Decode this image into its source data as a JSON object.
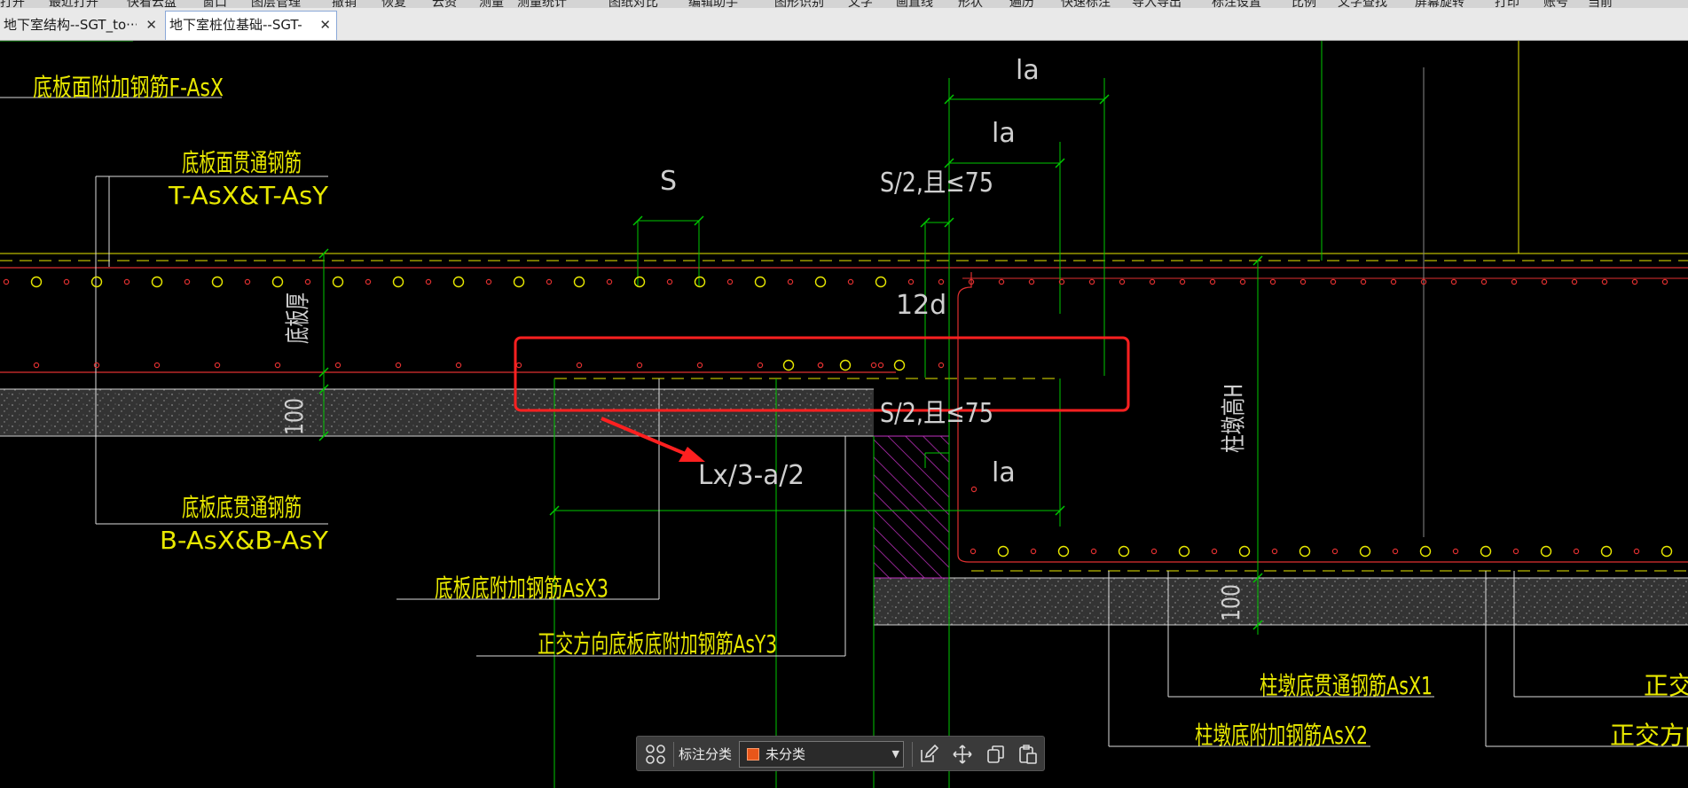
{
  "menubar": {
    "items": [
      "打开",
      "最近打开",
      "快看云盘",
      "窗口",
      "图层管理",
      "撤销",
      "恢复",
      "云资",
      "测量",
      "测量统计",
      "图纸对比",
      "编辑助手",
      "图形识别",
      "文字",
      "画直线",
      "形状",
      "遍历",
      "快速标注",
      "导入导出",
      "标注设置",
      "比例",
      "文字查找",
      "屏幕旋转",
      "打印",
      "账号",
      "当前"
    ]
  },
  "tabs": [
    {
      "label": "地下室结构--SGT_to···",
      "active": false,
      "close": "✕"
    },
    {
      "label": "地下室桩位基础--SGT-",
      "active": true,
      "close": "✕"
    }
  ],
  "drawing": {
    "labels": {
      "slab_top_extra": "底板面附加钢筋F-AsX",
      "slab_top_through_cn": "底板面贯通钢筋",
      "slab_top_through_code": "T-AsX&T-AsY",
      "slab_thickness": "底板厚",
      "cover_100_left": "100",
      "slab_bottom_through_cn": "底板底贯通钢筋",
      "slab_bottom_through_code": "B-AsX&B-AsY",
      "slab_bottom_extra": "底板底附加钢筋AsX3",
      "orth_bottom_extra": "正交方向底板底附加钢筋AsY3",
      "spacing_s": "S",
      "half_s_top": "S/2,且≤75",
      "half_s_bottom": "S/2,且≤75",
      "la_1": "la",
      "la_2": "la",
      "la_3": "la",
      "hook_12d": "12d",
      "lx_formula": "Lx/3-a/2",
      "cap_height": "柱墩高H",
      "cover_100_right": "100",
      "cap_bottom_through": "柱墩底贯通钢筋AsX1",
      "cap_bottom_extra": "柱墩底附加钢筋AsX2",
      "right_partial_1": "正交方",
      "right_partial_2": "正交方向柱"
    },
    "colors": {
      "text": "#e8e800",
      "dimension": "#00c800",
      "rebar": "#e03030",
      "concrete": "#6a6a6a",
      "highlight_box": "#ff2020",
      "hatch": "#c030c0",
      "leader": "#ffffff"
    }
  },
  "bottom_toolbar": {
    "grid_icon": "grid-icon",
    "label": "标注分类",
    "category_value": "未分类",
    "category_color": "#e8561a",
    "icons": [
      "edit-icon",
      "move-icon",
      "copy-icon",
      "paste-icon"
    ]
  }
}
